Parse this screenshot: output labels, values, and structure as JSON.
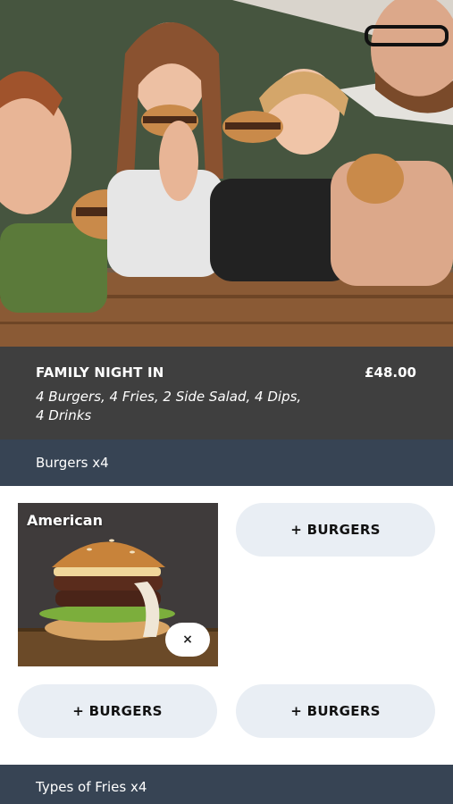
{
  "offer": {
    "title": "FAMILY NIGHT IN",
    "price": "£48.00",
    "description": "4 Burgers, 4 Fries, 2 Side Salad, 4 Dips, 4 Drinks"
  },
  "sections": [
    {
      "label": "Burgers x4"
    },
    {
      "label": "Types of Fries x4"
    }
  ],
  "burgers": {
    "selected": {
      "name": "American",
      "remove_icon": "×"
    },
    "add_label": "+ BURGERS"
  },
  "colors": {
    "info_bg": "#3f3f3f",
    "section_bg": "#374454",
    "button_bg": "#e9eef4"
  }
}
